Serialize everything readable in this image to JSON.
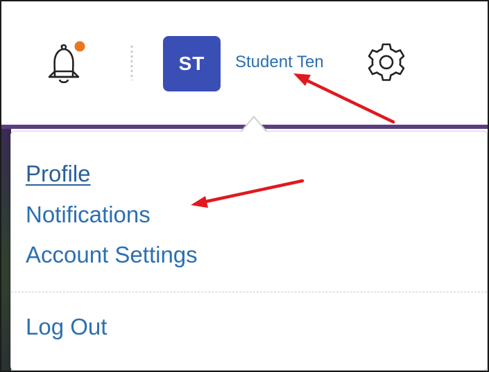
{
  "header": {
    "notification_icon": "bell-icon",
    "notification_badge_color": "#e87722",
    "avatar_initials": "ST",
    "avatar_color": "#3a4fb5",
    "user_name": "Student Ten",
    "settings_icon": "gear-icon"
  },
  "user_menu": {
    "items": [
      {
        "label": "Profile"
      },
      {
        "label": "Notifications"
      },
      {
        "label": "Account Settings"
      }
    ],
    "logout_label": "Log Out"
  },
  "annotations": {
    "arrow_color": "#e0191e"
  }
}
